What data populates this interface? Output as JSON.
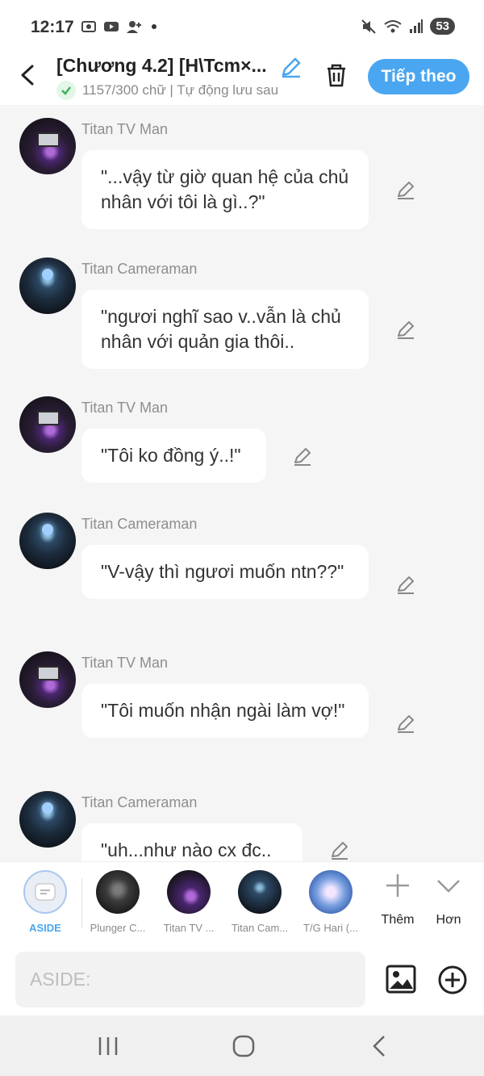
{
  "status_bar": {
    "time": "12:17",
    "battery": "53"
  },
  "header": {
    "title": "[Chương 4.2] [H\\Tcm×...",
    "subtitle": "1157/300 chữ | Tự động lưu sau",
    "next_label": "Tiếp theo"
  },
  "messages": [
    {
      "speaker": "Titan TV Man",
      "text": "\"...vậy từ giờ quan hệ của chủ nhân với tôi là gì..?\""
    },
    {
      "speaker": "Titan Cameraman",
      "text": "\"ngươi nghĩ sao v..vẫn là chủ nhân với quản gia thôi.."
    },
    {
      "speaker": "Titan TV Man",
      "text": "\"Tôi ko đồng ý..!\""
    },
    {
      "speaker": "Titan Cameraman",
      "text": "\"V-vậy thì ngươi muốn ntn??\""
    },
    {
      "speaker": "Titan TV Man",
      "text": "\"Tôi muốn nhận ngài làm vợ!\""
    },
    {
      "speaker": "Titan Cameraman",
      "text": "\"uh...như nào cx đc.."
    }
  ],
  "characters": {
    "aside": "ASIDE",
    "items": [
      "Plunger C...",
      "Titan TV ...",
      "Titan Cam...",
      "T/G Hari (..."
    ],
    "more": "Thêm",
    "collapse": "Hơn"
  },
  "input": {
    "placeholder": "ASIDE:"
  },
  "colors": {
    "accent": "#4aa6f0",
    "background": "#f5f5f5"
  }
}
